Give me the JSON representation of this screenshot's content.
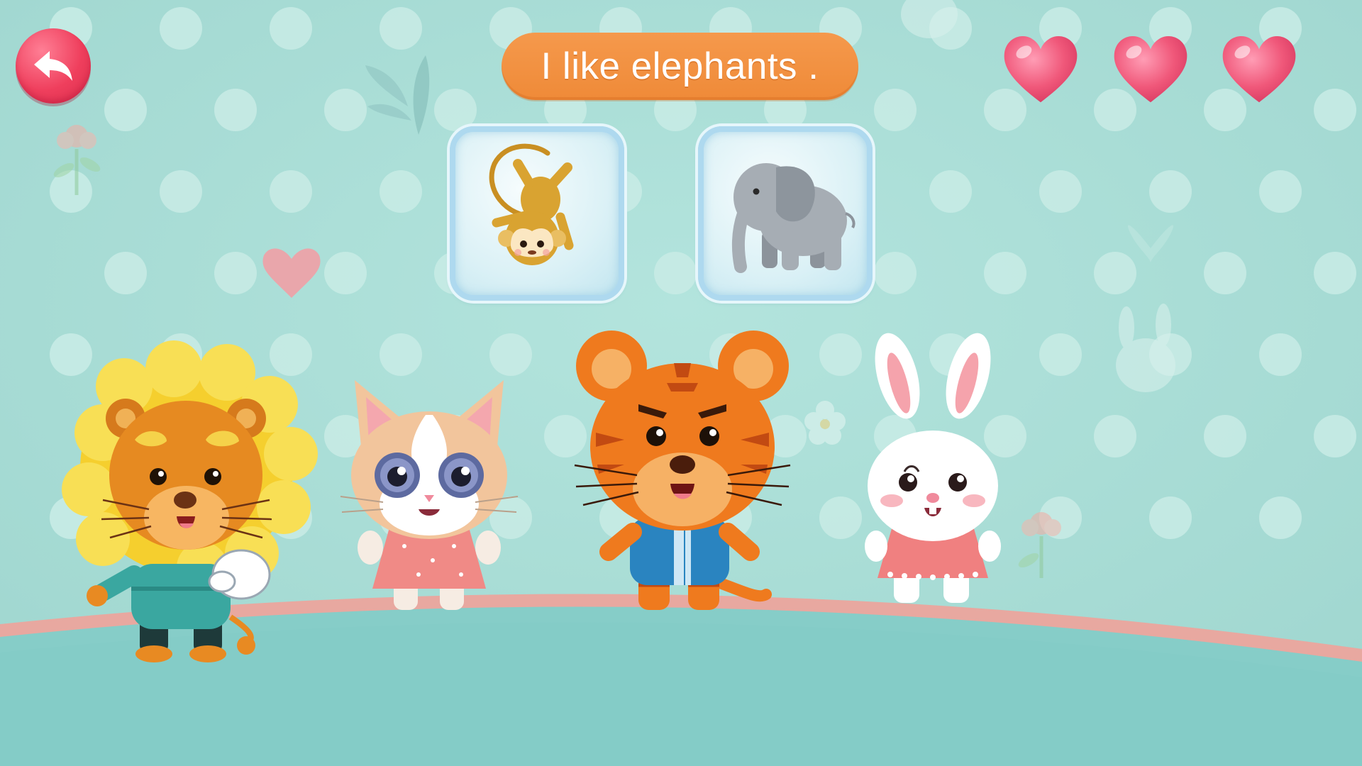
{
  "header": {
    "sentence": "I like elephants ."
  },
  "nav": {
    "back_icon": "back-arrow-icon"
  },
  "lives": {
    "count": 3,
    "icon": "heart-icon",
    "color": "#f0587a"
  },
  "choices": [
    {
      "animal": "monkey",
      "icon": "monkey-icon"
    },
    {
      "animal": "elephant",
      "icon": "elephant-icon"
    }
  ],
  "characters": [
    "lion",
    "cat",
    "tiger",
    "rabbit"
  ],
  "colors": {
    "background": "#a7ddd6",
    "floor": "#86cdc8",
    "floor_edge": "#e8a8a0",
    "pill": "#f08e3d",
    "back_button": "#ef3f5d"
  }
}
